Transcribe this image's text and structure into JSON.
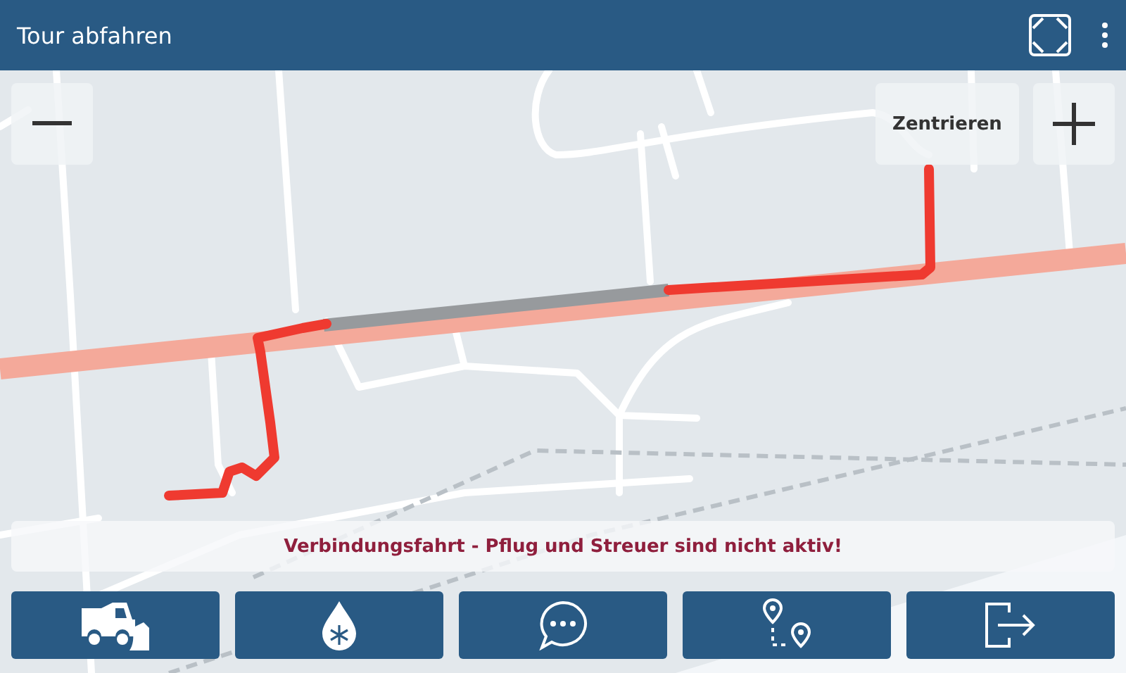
{
  "window": {
    "title": "Tour abfahren"
  },
  "map": {
    "center_button": "Zentrieren"
  },
  "notice": {
    "text": "Verbindungsfahrt - Pflug und Streuer sind nicht aktiv!"
  },
  "buttons": [
    {
      "kind": "plow"
    },
    {
      "kind": "spread"
    },
    {
      "kind": "message"
    },
    {
      "kind": "route"
    },
    {
      "kind": "exit"
    }
  ]
}
